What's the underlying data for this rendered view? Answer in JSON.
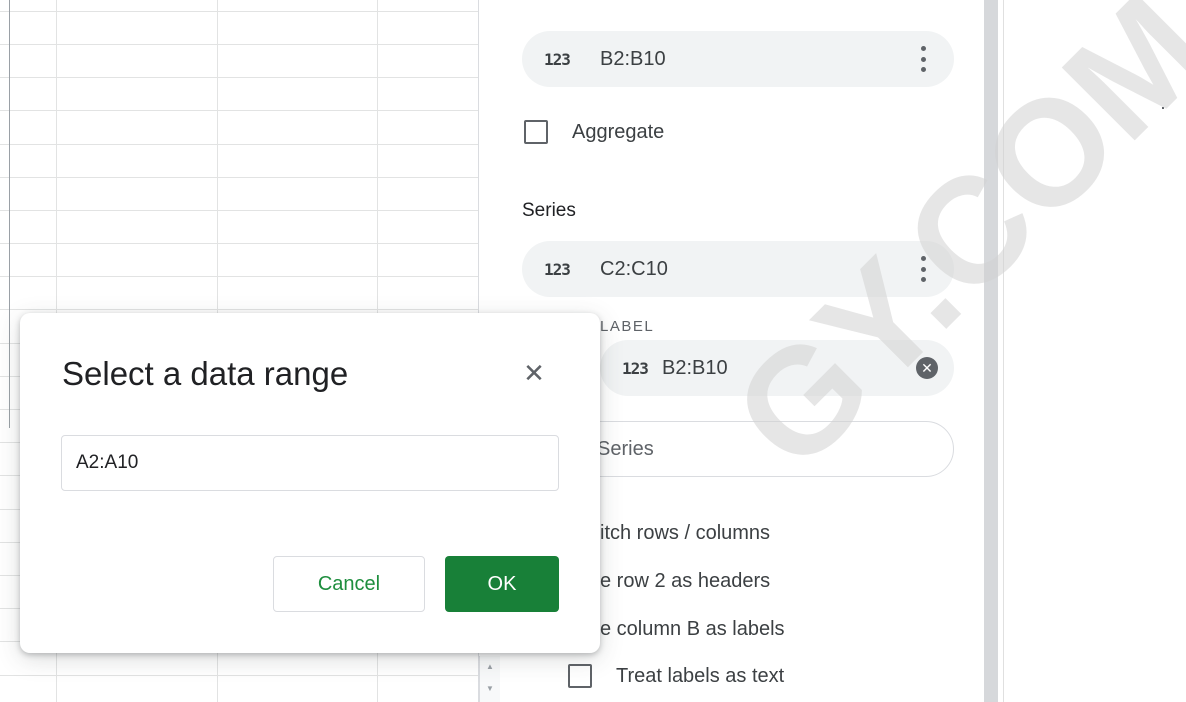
{
  "panel": {
    "x_axis_chip": {
      "icon": "123",
      "range": "B2:B10"
    },
    "aggregate_label": "Aggregate",
    "series_title": "Series",
    "series_chip": {
      "icon": "123",
      "range": "C2:C10"
    },
    "label_caption": "LABEL",
    "label_chip": {
      "icon": "123",
      "range": "B2:B10"
    },
    "add_series_partial": "Series",
    "switch_rows_partial": "itch rows / columns",
    "use_row_partial": "e row 2 as headers",
    "use_column_partial": "e column B as labels",
    "treat_labels_label": "Treat labels as text"
  },
  "dialog": {
    "title": "Select a data range",
    "close_symbol": "✕",
    "range_value": "A2:A10",
    "cancel_label": "Cancel",
    "ok_label": "OK"
  },
  "watermark": {
    "text": "GY.COM"
  },
  "colors": {
    "ok_green": "#188038",
    "cancel_text_green": "#1e8e3e",
    "chip_bg": "#f1f3f4"
  }
}
